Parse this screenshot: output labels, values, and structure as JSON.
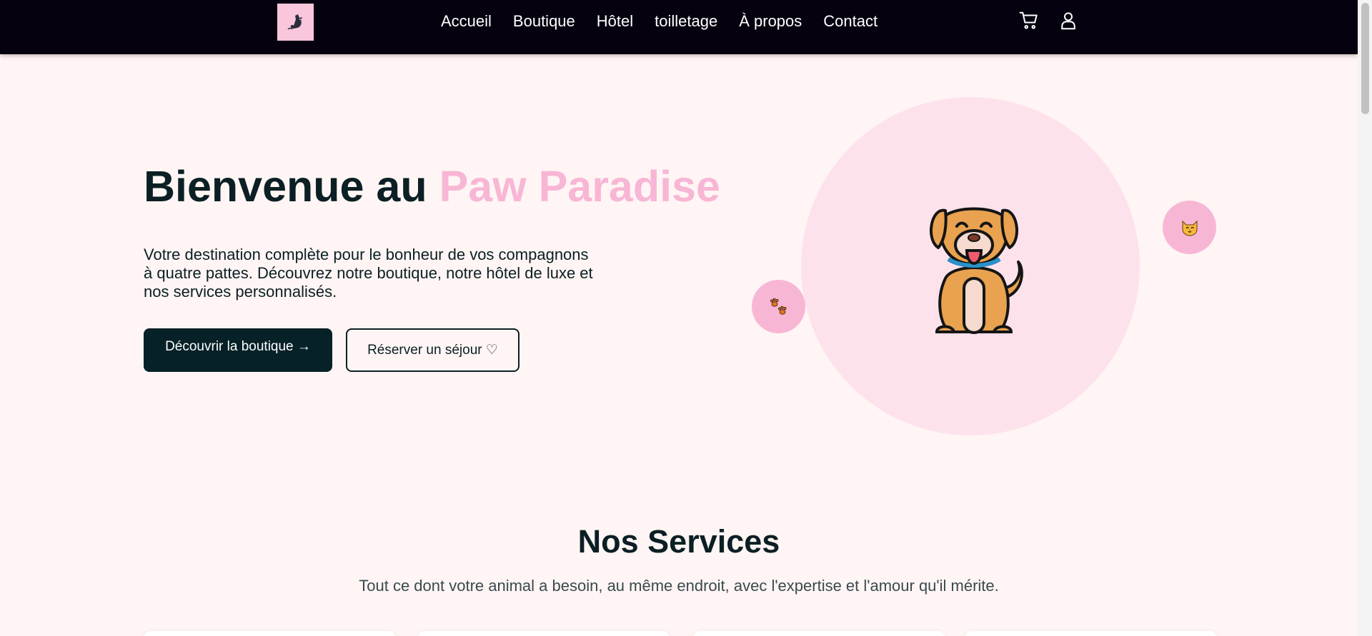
{
  "nav": {
    "links": [
      "Accueil",
      "Boutique",
      "Hôtel",
      "toilletage",
      "À propos",
      "Contact"
    ],
    "icons": {
      "logo": "cat-logo-icon",
      "cart": "cart-icon",
      "user": "user-icon"
    }
  },
  "hero": {
    "title_prefix": "Bienvenue au ",
    "title_accent": "Paw Paradise",
    "description": "Votre destination complète pour le bonheur de vos compagnons à quatre pattes. Découvrez notre boutique, notre hôtel de luxe et nos services personnalisés.",
    "primary_button": "Découvrir la boutique →",
    "secondary_button": "Réserver un séjour ♡",
    "illustration": "dog-illustration",
    "badges": [
      "paw-prints-icon",
      "cat-face-icon"
    ]
  },
  "services": {
    "title": "Nos Services",
    "subtitle": "Tout ce dont votre animal a besoin, au même endroit, avec l'expertise et l'amour qu'il mérite."
  },
  "colors": {
    "navbar": "#06010f",
    "background": "#fff5f4",
    "accent_pink": "#f8b6d5",
    "circle": "#fde2ec",
    "primary_button": "#062127",
    "text_dark": "#0b1f24"
  }
}
